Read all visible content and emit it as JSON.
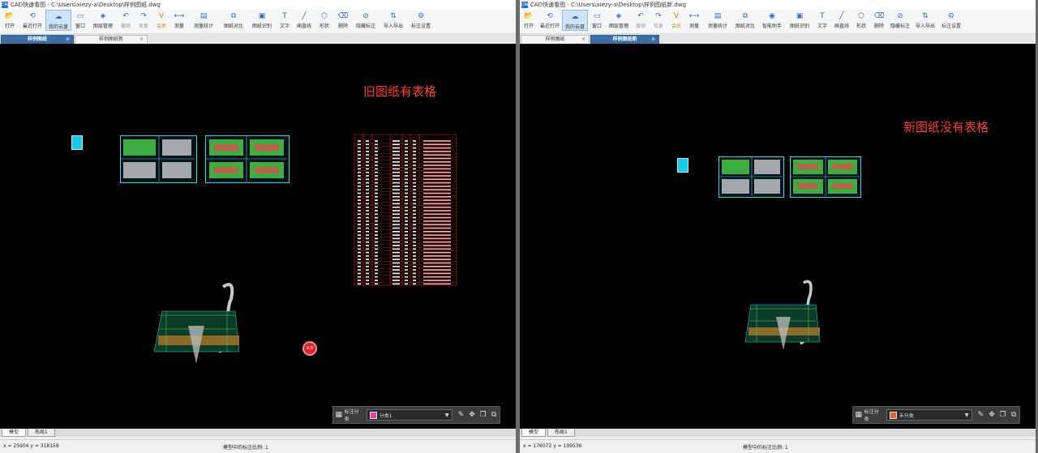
{
  "left": {
    "title": "CAD快速看图 - C:\\Users\\xiezy-a\\Desktop\\样例图纸.dwg",
    "toolbar": [
      "打开",
      "最近打开",
      "我的云盘",
      "窗口",
      "图层管理",
      "撤销",
      "恢复",
      "会员",
      "测量",
      "测量统计",
      "图纸对比",
      "图纸识别",
      "文字",
      "画直线",
      "形状",
      "删除",
      "隐藏标注",
      "导入导出",
      "标注设置"
    ],
    "tabs": [
      {
        "label": "样例图纸",
        "active": true
      },
      {
        "label": "样例图纸新",
        "active": false
      }
    ],
    "note": "旧图纸有表格",
    "dock": {
      "label": "标注分类",
      "value": "分类1",
      "swatch": "#e0409a"
    },
    "bottom_tabs": [
      "模型",
      "布局1"
    ],
    "status": {
      "coord": "x = 25904  y = 318158",
      "scale": "模型中的标注比例: 1"
    },
    "red_button": "9,9"
  },
  "right": {
    "title": "CAD快速看图 - C:\\Users\\xiezy-a\\Desktop\\样例图纸新.dwg",
    "toolbar": [
      "打开",
      "最近打开",
      "我的云盘",
      "窗口",
      "图层管理",
      "撤销",
      "恢复",
      "会员",
      "测量",
      "测量统计",
      "图纸对比",
      "智能助手",
      "图纸识别",
      "文字",
      "画直线",
      "形状",
      "删除",
      "隐藏标注",
      "导入导出",
      "标注设置"
    ],
    "tabs": [
      {
        "label": "样例图纸",
        "active": false
      },
      {
        "label": "样例图纸新",
        "active": true
      }
    ],
    "note": "新图纸没有表格",
    "dock": {
      "label": "标注分类",
      "value": "未分类",
      "swatch": "#e06418"
    },
    "bottom_tabs": [
      "模型",
      "布局1"
    ],
    "status": {
      "coord": "x = 176072  y = 199536",
      "scale": "模型中的标注比例: 1"
    }
  },
  "colors": {
    "canvas": "#000000",
    "note": "#ff3b3b",
    "sheet_border": "#2fd6e6",
    "table": "#ff2a2a",
    "accent": "#2d6fd1"
  }
}
